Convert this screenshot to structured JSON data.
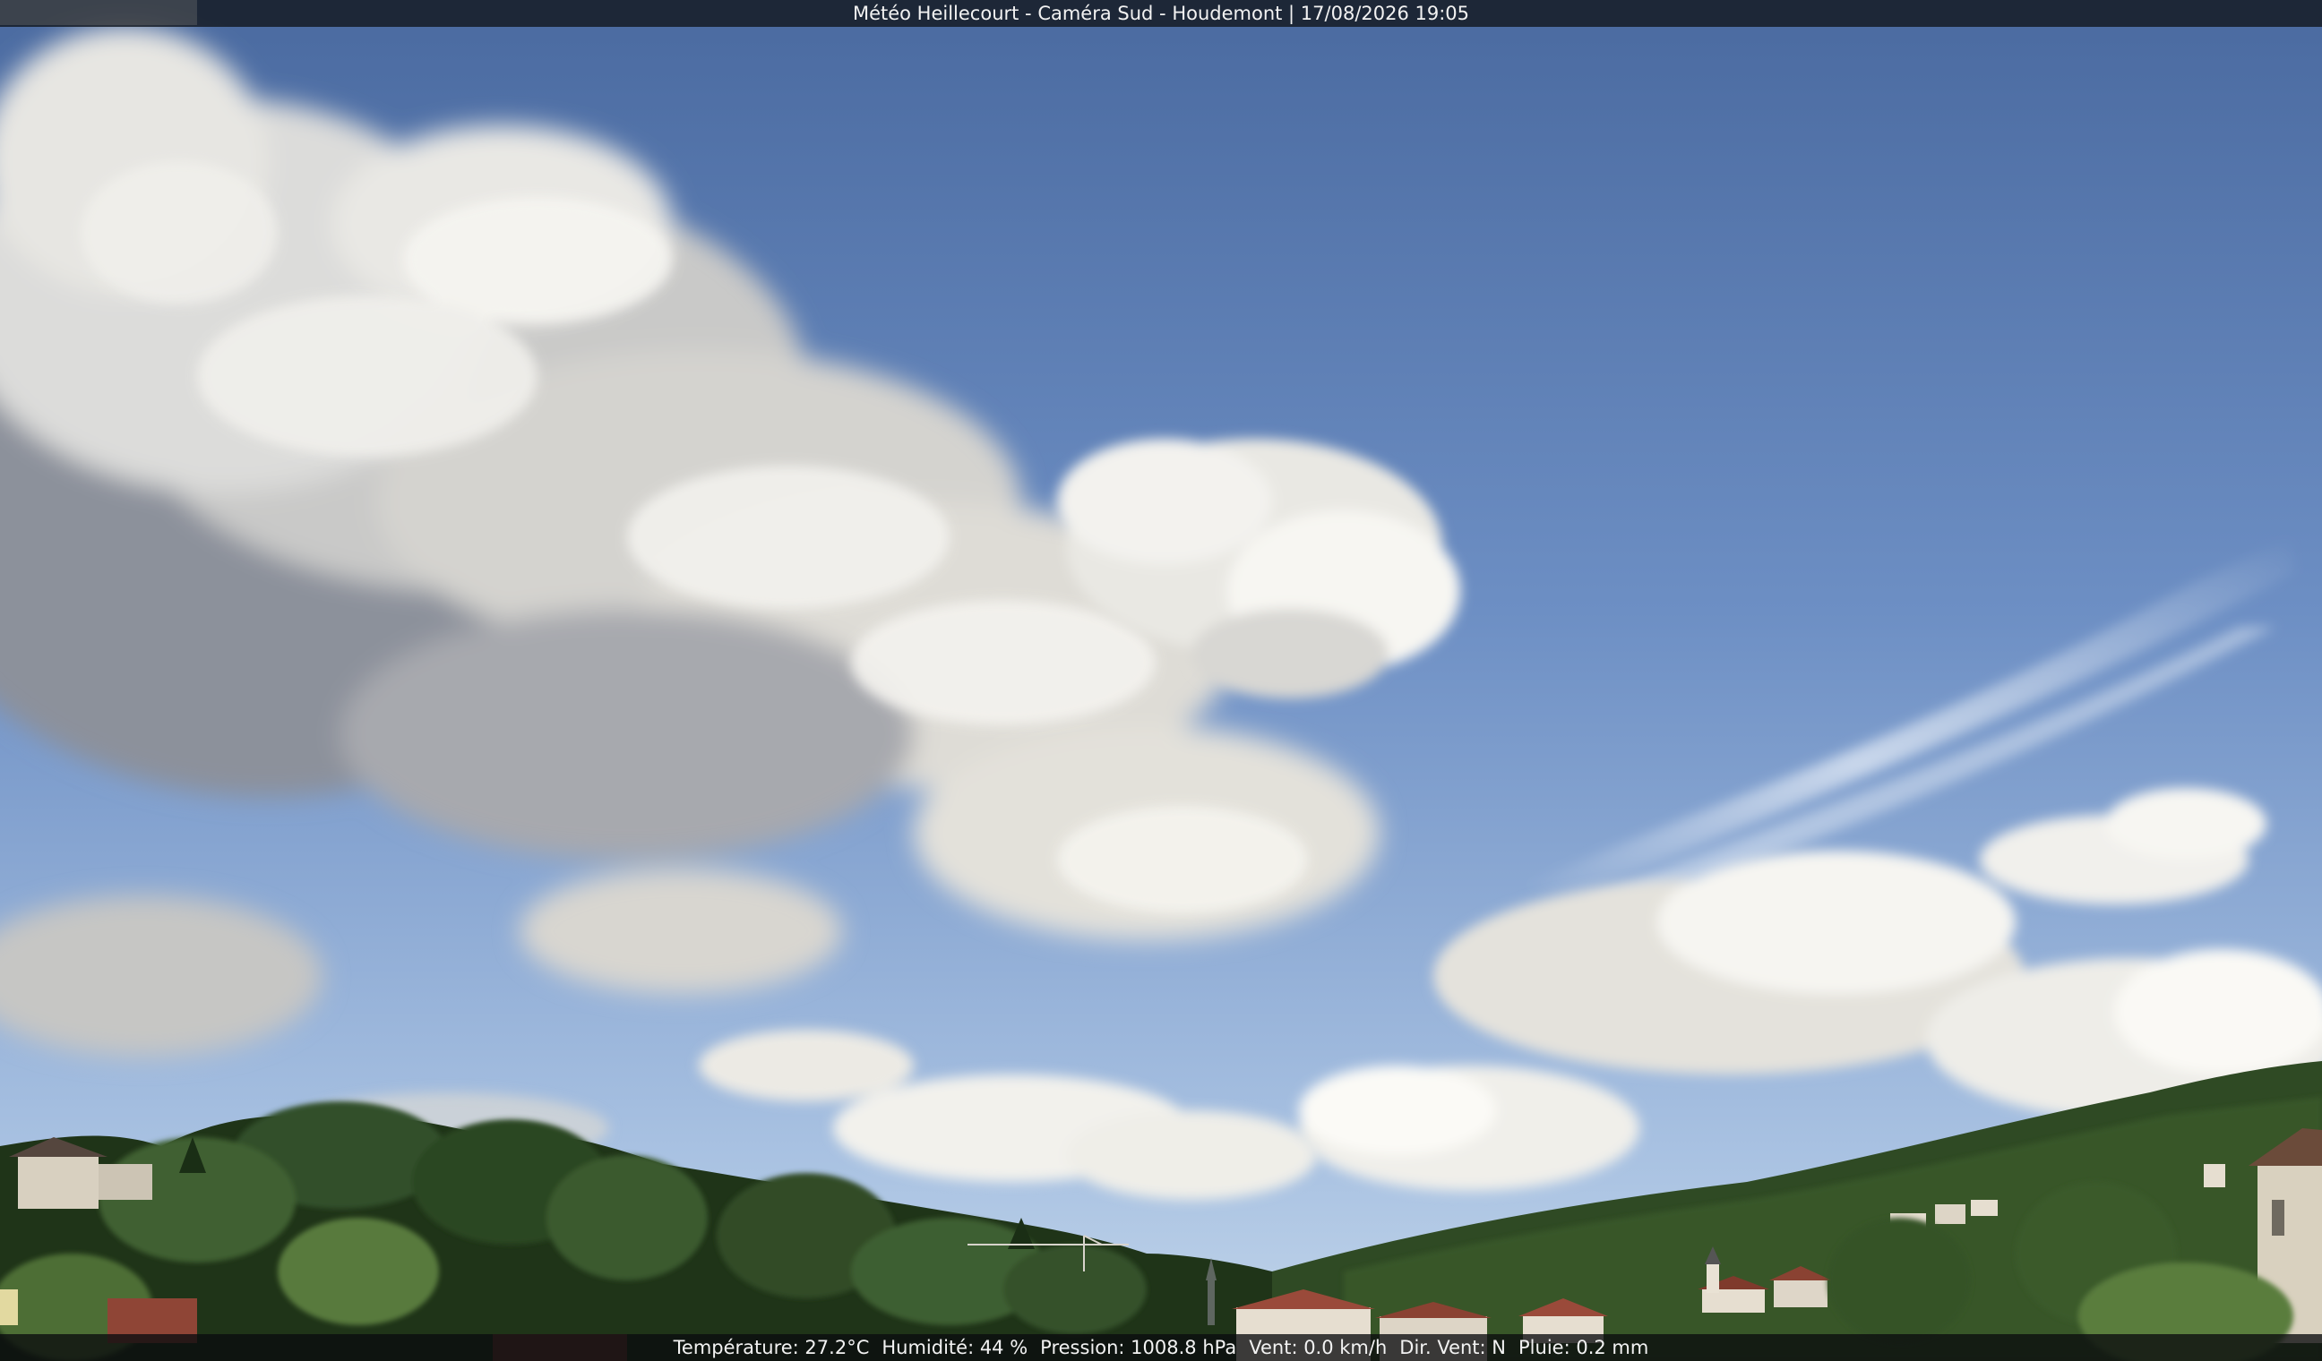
{
  "header": {
    "station": "Météo Heillecourt",
    "camera": "Caméra Sud",
    "location": "Houdemont",
    "datetime": "17/08/2026 19:05",
    "sep1": " - ",
    "sep2": " - ",
    "sep3": " | "
  },
  "footer": {
    "temperature": "Température: 27.2°C",
    "humidity": "Humidité: 44 %",
    "pressure": "Pression: 1008.8 hPa",
    "wind_speed": "Vent: 0.0 km/h",
    "wind_dir": "Dir. Vent: N",
    "rain": "Pluie: 0.2 mm"
  },
  "colors": {
    "sky_top": "#4a6aa0",
    "sky_mid": "#6d8fc4",
    "sky_horizon": "#b9cfe6",
    "cloud_light": "#f3f1ec",
    "cloud_shadow": "#8a8f99",
    "trees_dark": "#1f3418",
    "trees_mid": "#38552a",
    "trees_light": "#587a3c",
    "hill": "#2f4a24",
    "roof": "#9a4a3a",
    "wall": "#e6ded0"
  }
}
